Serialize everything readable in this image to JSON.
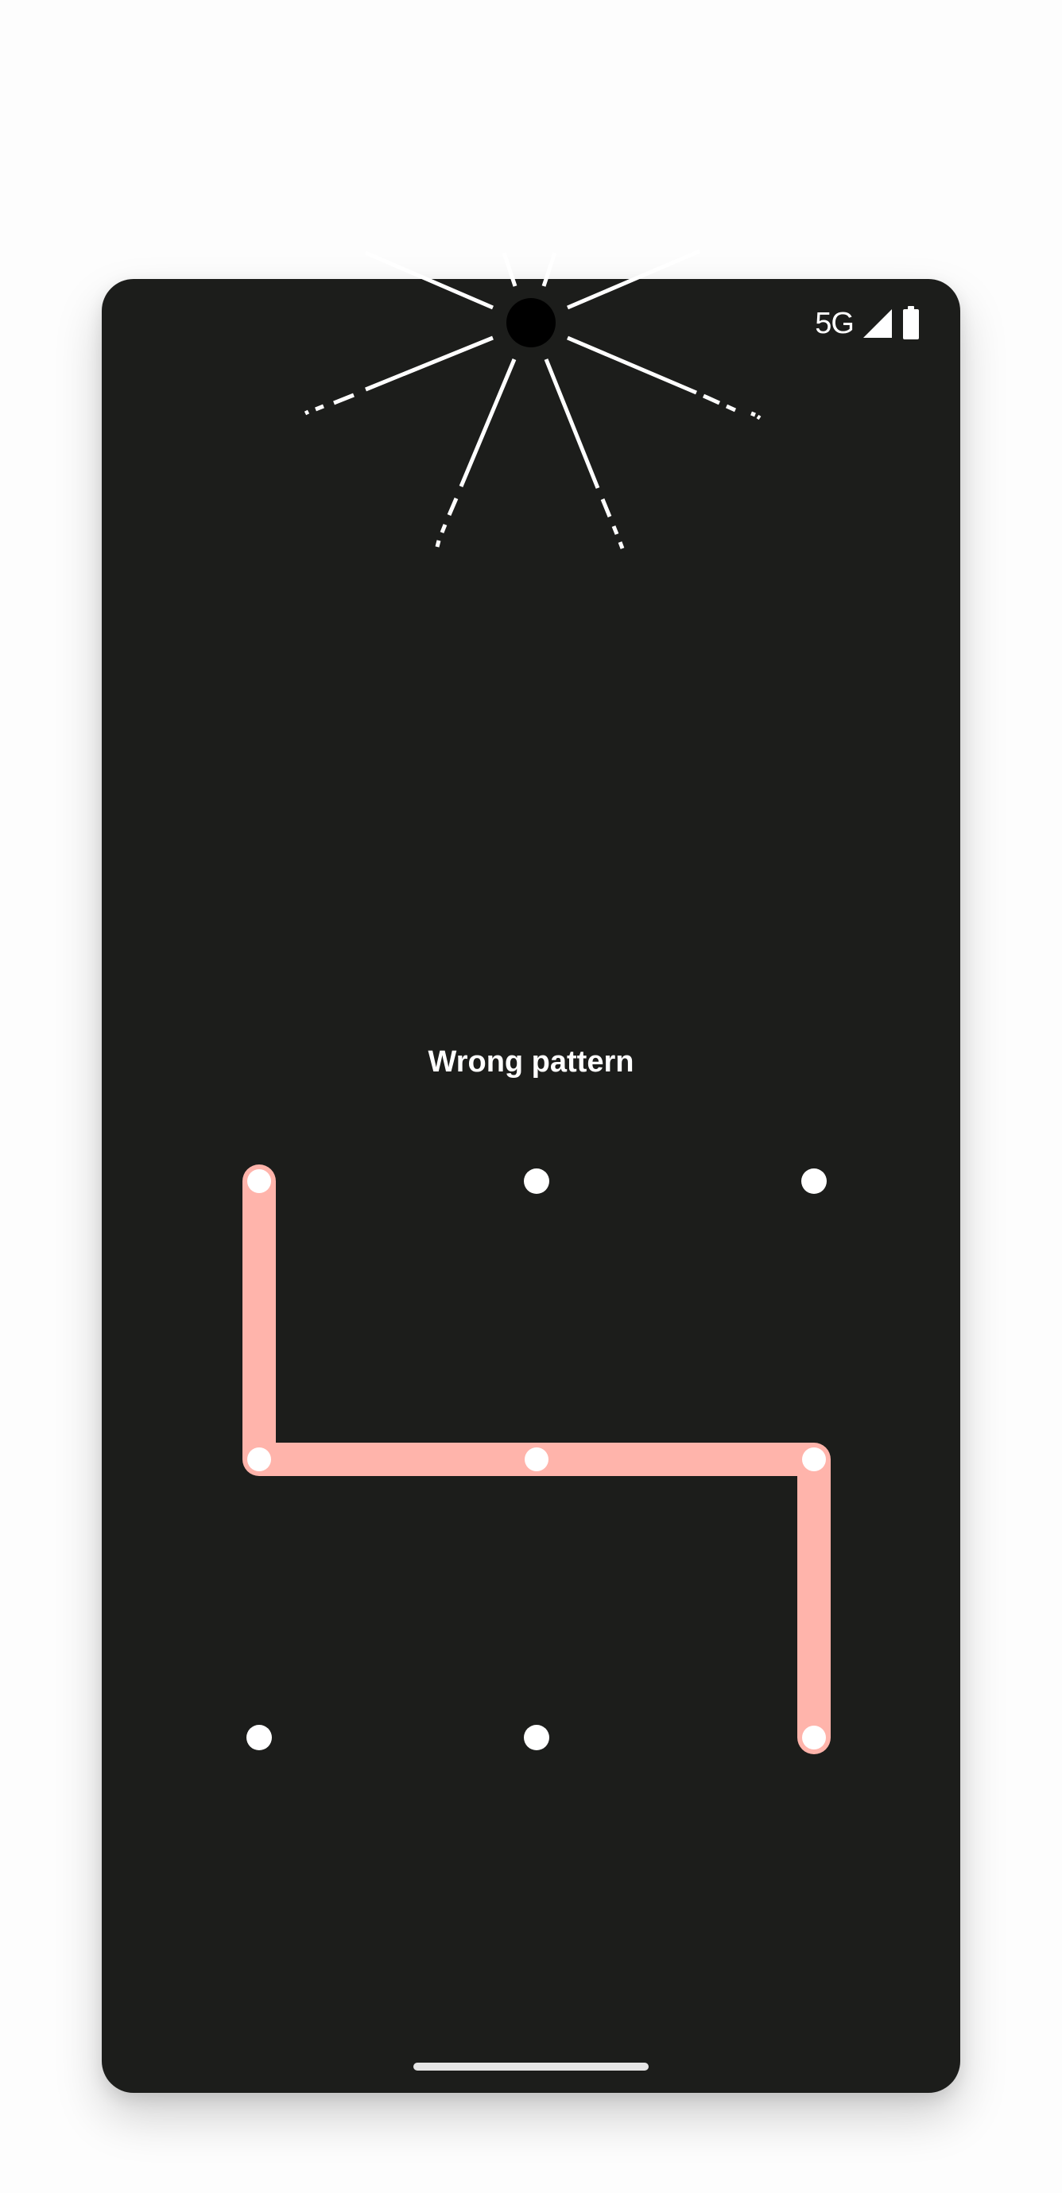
{
  "status_bar": {
    "network_label": "5G",
    "signal_icon": "signal-icon",
    "battery_icon": "battery-icon"
  },
  "lock_screen": {
    "message": "Wrong pattern",
    "pattern_state": "error",
    "error_color": "#ffb4ab",
    "dot_color": "#ffffff",
    "background_color": "#1c1d1b",
    "selected_sequence": [
      1,
      4,
      5,
      6,
      9
    ],
    "grid": [
      {
        "id": 1,
        "selected": true
      },
      {
        "id": 2,
        "selected": false
      },
      {
        "id": 3,
        "selected": false
      },
      {
        "id": 4,
        "selected": true
      },
      {
        "id": 5,
        "selected": true
      },
      {
        "id": 6,
        "selected": true
      },
      {
        "id": 7,
        "selected": false
      },
      {
        "id": 8,
        "selected": false
      },
      {
        "id": 9,
        "selected": true
      }
    ]
  },
  "camera": {
    "icon": "camera-cutout-icon"
  },
  "navigation": {
    "home_indicator": "home-indicator"
  }
}
